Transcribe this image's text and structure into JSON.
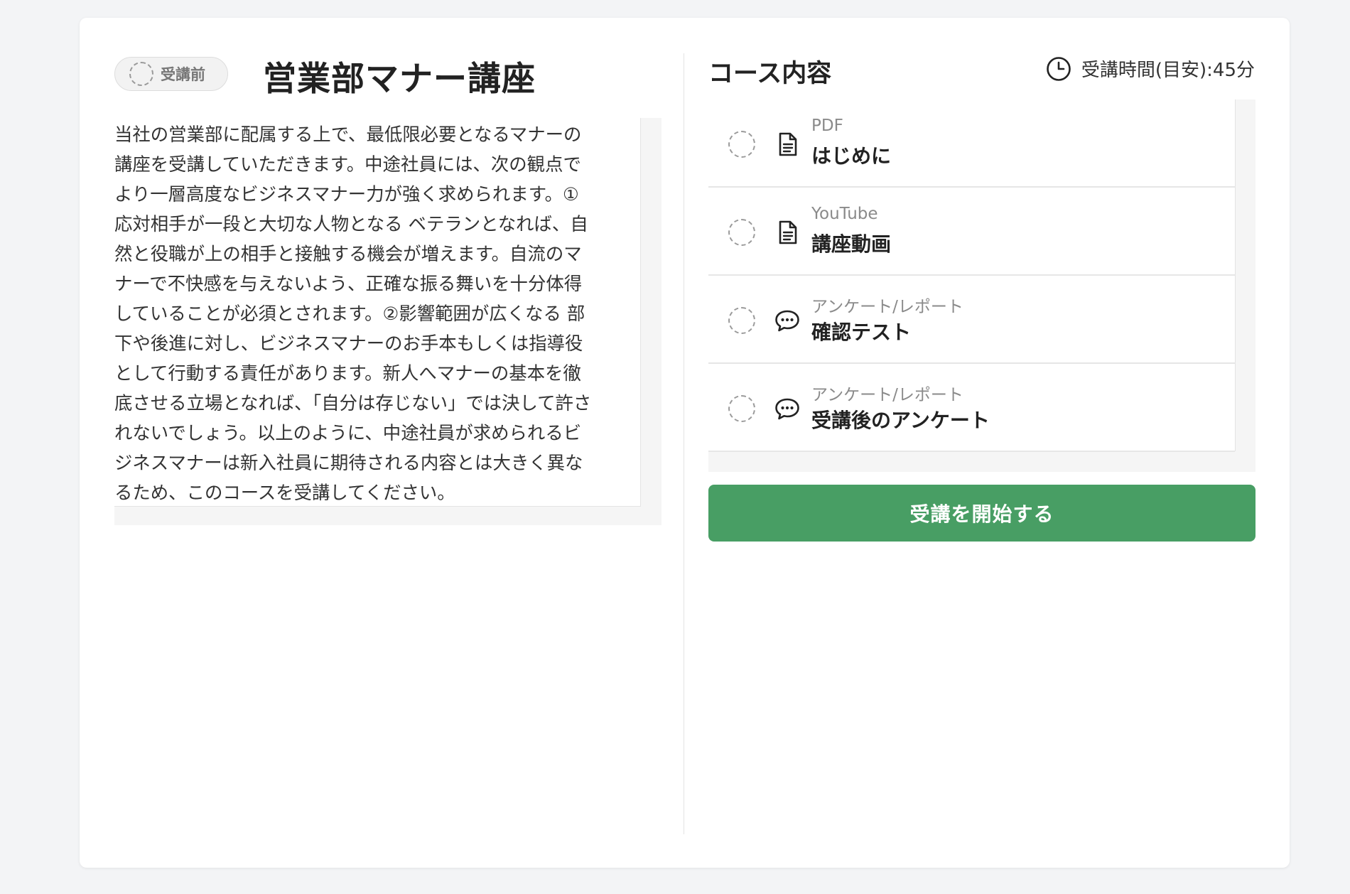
{
  "left": {
    "status_label": "受講前",
    "title": "営業部マナー講座",
    "description_lines": [
      "当社の営業部に配属する上で、最低限必要となるマナーの",
      "講座を受講していただきます。中途社員には、次の観点で",
      "より一層高度なビジネスマナー力が強く求められます。①",
      "応対相手が一段と大切な人物となる ベテランとなれば、自",
      "然と役職が上の相手と接触する機会が増えます。自流のマ",
      "ナーで不快感を与えないよう、正確な振る舞いを十分体得",
      "していることが必須とされます。②影響範囲が広くなる 部",
      "下や後進に対し、ビジネスマナーのお手本もしくは指導役",
      "として行動する責任があります。新人へマナーの基本を徹",
      "底させる立場となれば、「自分は存じない」では決して許さ",
      "れないでしょう。以上のように、中途社員が求められるビ",
      "ジネスマナーは新入社員に期待される内容とは大きく異な",
      "るため、このコースを受講してください。"
    ]
  },
  "right": {
    "section_title": "コース内容",
    "duration": "受講時間(目安):45分",
    "items": [
      {
        "type": "PDF",
        "name": "はじめに",
        "icon": "document-icon"
      },
      {
        "type": "YouTube",
        "name": "講座動画",
        "icon": "document-icon"
      },
      {
        "type": "アンケート/レポート",
        "name": "確認テスト",
        "icon": "chat-icon"
      },
      {
        "type": "アンケート/レポート",
        "name": "受講後のアンケート",
        "icon": "chat-icon"
      }
    ],
    "start_button": "受講を開始する"
  },
  "colors": {
    "accent": "#489e64",
    "page_bg": "#f3f4f6"
  }
}
